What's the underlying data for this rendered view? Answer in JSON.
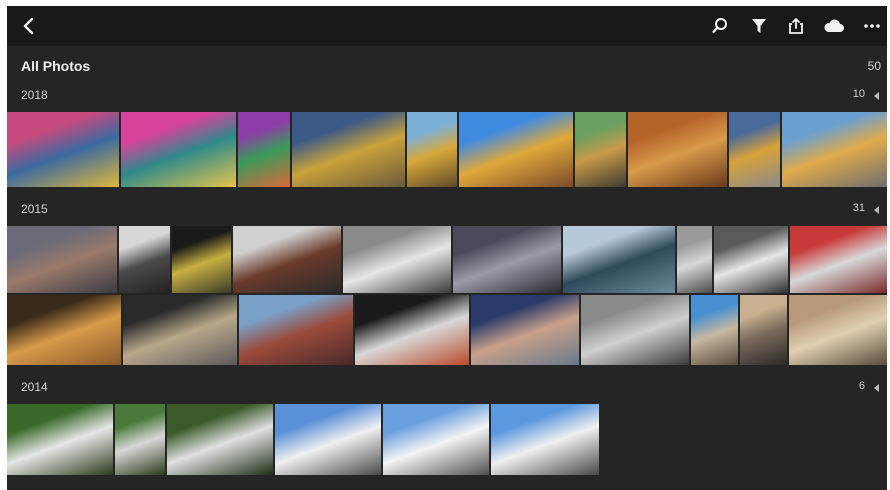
{
  "toolbar": {
    "back_icon": "chevron-left-icon",
    "right_icons": [
      "search-icon",
      "filter-icon",
      "share-icon",
      "cloud-icon",
      "more-icon"
    ]
  },
  "album": {
    "title": "All Photos",
    "count": "50"
  },
  "sections": [
    {
      "year": "2018",
      "count": "10",
      "photos": [
        {
          "subject": "graffiti wall",
          "c1": "#c64a7e",
          "c2": "#3b6aa0",
          "c3": "#e0b83a"
        },
        {
          "subject": "graffiti wall",
          "c1": "#d7439c",
          "c2": "#2f8a8a",
          "c3": "#e6c44b"
        },
        {
          "subject": "graffiti wall",
          "c1": "#8d3ea8",
          "c2": "#3a9a5a",
          "c3": "#d86a3a"
        },
        {
          "subject": "yellow house",
          "c1": "#3b5a86",
          "c2": "#c9a23a",
          "c3": "#6c5a3a"
        },
        {
          "subject": "yellow house",
          "c1": "#7ab0d8",
          "c2": "#d8a83a",
          "c3": "#5e4a2a"
        },
        {
          "subject": "yellow row houses",
          "c1": "#3f8be0",
          "c2": "#e0a83a",
          "c3": "#7a4a2a"
        },
        {
          "subject": "tree and facade",
          "c1": "#6aa060",
          "c2": "#c89a4a",
          "c3": "#3e3a2e"
        },
        {
          "subject": "orange wall",
          "c1": "#b5642a",
          "c2": "#d89a4a",
          "c3": "#6a3a1a"
        },
        {
          "subject": "yellow house",
          "c1": "#4a6a9a",
          "c2": "#d8a23a",
          "c3": "#8a8a8a"
        },
        {
          "subject": "yellow street",
          "c1": "#6aa0d0",
          "c2": "#e0aa4a",
          "c3": "#6e6e6e"
        }
      ]
    },
    {
      "year": "2015",
      "count": "31",
      "photos": [
        {
          "subject": "building facade",
          "c1": "#6a6a78",
          "c2": "#9a7a6a",
          "c3": "#3a3a44"
        },
        {
          "subject": "skyscraper",
          "c1": "#d8d8d8",
          "c2": "#4a4a4a",
          "c3": "#222222"
        },
        {
          "subject": "night streak",
          "c1": "#1a1a1a",
          "c2": "#c8b040",
          "c3": "#3a3a2a"
        },
        {
          "subject": "steam",
          "c1": "#d0d0d0",
          "c2": "#6a3a2a",
          "c3": "#2a2a2a"
        },
        {
          "subject": "glass building",
          "c1": "#8a8a8a",
          "c2": "#e6e6e6",
          "c3": "#3a3a3a"
        },
        {
          "subject": "glass building",
          "c1": "#4a4a5a",
          "c2": "#9a9aa8",
          "c3": "#2a2a30"
        },
        {
          "subject": "ferris wheel",
          "c1": "#b8c8d8",
          "c2": "#2e4a5a",
          "c3": "#6a8a9a"
        },
        {
          "subject": "crosswalk",
          "c1": "#9a9a9a",
          "c2": "#d8d8d8",
          "c3": "#4a4a4a"
        },
        {
          "subject": "street signs",
          "c1": "#5a5a5a",
          "c2": "#e6e6e6",
          "c3": "#303030"
        },
        {
          "subject": "red billboard",
          "c1": "#c83a3a",
          "c2": "#d8d8d8",
          "c3": "#7a2a2a"
        },
        {
          "subject": "timber house",
          "c1": "#3a2a1a",
          "c2": "#d89a4a",
          "c3": "#8a5a2a"
        },
        {
          "subject": "windows",
          "c1": "#2a2a2a",
          "c2": "#b8a88a",
          "c3": "#5a5a5a"
        },
        {
          "subject": "red brick",
          "c1": "#7aa0c8",
          "c2": "#9a4a3a",
          "c3": "#4a2a2a"
        },
        {
          "subject": "lamp and smoke",
          "c1": "#1a1a1a",
          "c2": "#d8d8d8",
          "c3": "#b84a2a"
        },
        {
          "subject": "comic mural",
          "c1": "#2a3a6a",
          "c2": "#c8a08a",
          "c3": "#6a7a8a"
        },
        {
          "subject": "roses",
          "c1": "#8a8a8a",
          "c2": "#d0d0d0",
          "c3": "#3a3a3a"
        },
        {
          "subject": "courtyard",
          "c1": "#4a90d0",
          "c2": "#c8b8a0",
          "c3": "#5a4a3a"
        },
        {
          "subject": "arches",
          "c1": "#c8b090",
          "c2": "#7a6a5a",
          "c3": "#2a2a2a"
        },
        {
          "subject": "spiral stair",
          "c1": "#b89a7a",
          "c2": "#e0d0b0",
          "c3": "#5a4a3a"
        },
        {
          "subject": "stairs",
          "c1": "#8a8a8a",
          "c2": "#d8d8d8",
          "c3": "#3a3a3a"
        }
      ]
    },
    {
      "year": "2014",
      "count": "6",
      "photos": [
        {
          "subject": "waterfall",
          "c1": "#3a6a2a",
          "c2": "#e6e6e6",
          "c3": "#2a3a1a"
        },
        {
          "subject": "waterfall",
          "c1": "#4a7a3a",
          "c2": "#d8d8d8",
          "c3": "#2a3a1a"
        },
        {
          "subject": "waterfall",
          "c1": "#3a5a2a",
          "c2": "#e0e0e0",
          "c3": "#1e2e16"
        },
        {
          "subject": "mountains",
          "c1": "#5a90d8",
          "c2": "#f0f0f0",
          "c3": "#4a4a4a"
        },
        {
          "subject": "mountains",
          "c1": "#6aa0e0",
          "c2": "#f4f4f4",
          "c3": "#505050"
        },
        {
          "subject": "mountains",
          "c1": "#5a98e0",
          "c2": "#f0f0f0",
          "c3": "#484848"
        }
      ]
    }
  ]
}
